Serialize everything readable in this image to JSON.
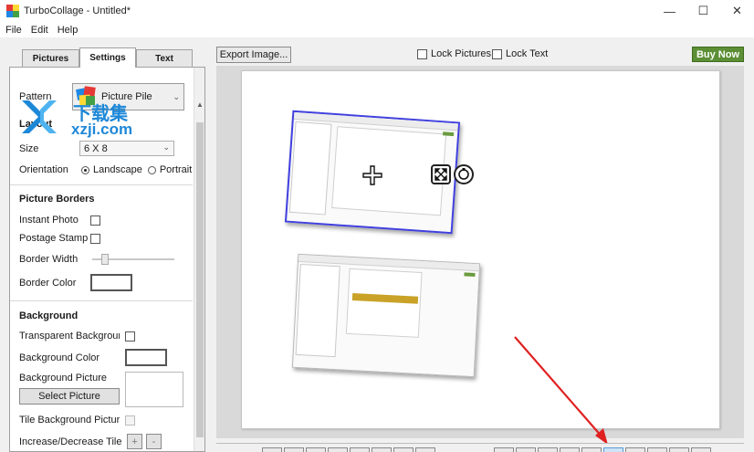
{
  "window": {
    "title": "TurboCollage - Untitled*",
    "controls": {
      "minimize": "—",
      "maximize": "☐",
      "close": "✕"
    }
  },
  "menu": {
    "file": "File",
    "edit": "Edit",
    "help": "Help"
  },
  "tabs": {
    "pictures": "Pictures",
    "settings": "Settings",
    "text": "Text"
  },
  "settings": {
    "pattern_label": "Pattern",
    "pattern_value": "Picture Pile",
    "layout_title": "Layout",
    "size_label": "Size",
    "size_value": "6 X 8",
    "orientation_label": "Orientation",
    "landscape": "Landscape",
    "portrait": "Portrait",
    "picture_borders_title": "Picture Borders",
    "instant_photo": "Instant Photo",
    "postage_stamp": "Postage Stamp",
    "border_width": "Border Width",
    "border_color": "Border Color",
    "background_title": "Background",
    "transparent_background": "Transparent Background",
    "background_color": "Background Color",
    "background_picture": "Background Picture",
    "select_picture": "Select Picture",
    "tile_background_picture": "Tile Background Picture",
    "increase_decrease_tile": "Increase/Decrease Tile",
    "plus": "+",
    "minus": "-"
  },
  "toolbar": {
    "export_image": "Export Image...",
    "lock_pictures": "Lock Pictures",
    "lock_text": "Lock Text",
    "buy_now": "Buy Now"
  },
  "watermark": {
    "cn": "下载集",
    "domain": "xzji.com"
  },
  "colors": {
    "accent_green": "#5c8f35",
    "selection_blue": "#4040e0",
    "annotation_arrow": "#e02020",
    "watermark_blue": "#1e88d8"
  }
}
